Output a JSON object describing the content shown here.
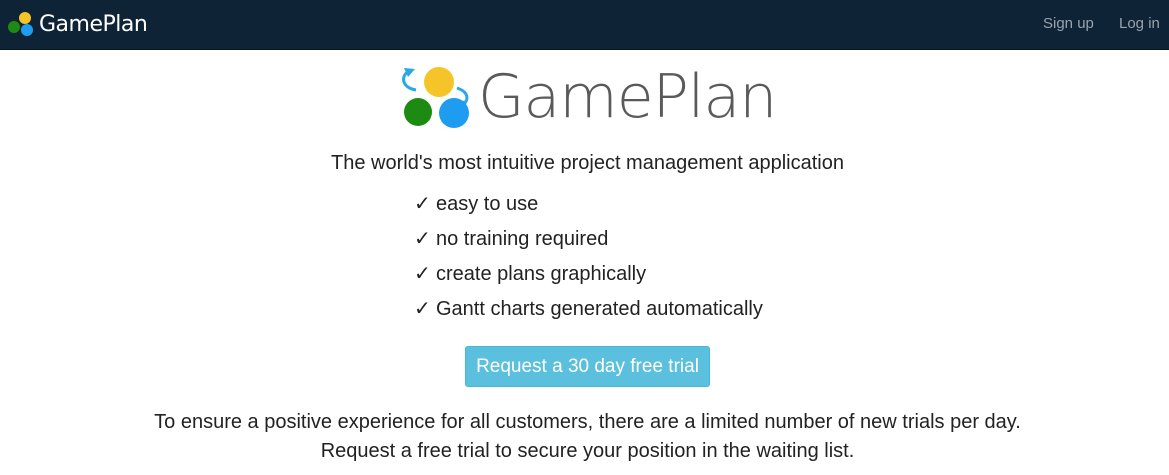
{
  "navbar": {
    "brand": "GamePlan",
    "links": [
      {
        "label": "Sign up"
      },
      {
        "label": "Log in"
      }
    ]
  },
  "hero": {
    "wordmark": "GamePlan",
    "tagline": "The world's most intuitive project management application",
    "features": [
      {
        "check": "✓",
        "text": "easy to use"
      },
      {
        "check": "✓",
        "text": "no training required"
      },
      {
        "check": "✓",
        "text": "create plans graphically"
      },
      {
        "check": "✓",
        "text": "Gantt charts generated automatically"
      }
    ],
    "cta_label": "Request a 30 day free trial",
    "notice_line1": "To ensure a positive experience for all customers, there are a limited number of new trials per day.",
    "notice_line2": "Request a free trial to secure your position in the waiting list."
  },
  "colors": {
    "navbar_bg": "#0e2336",
    "cta_bg": "#5bc0de",
    "logo_yellow": "#f5c428",
    "logo_green": "#1d8a12",
    "logo_blue": "#1e9df0",
    "logo_arrow": "#29a8e8"
  }
}
